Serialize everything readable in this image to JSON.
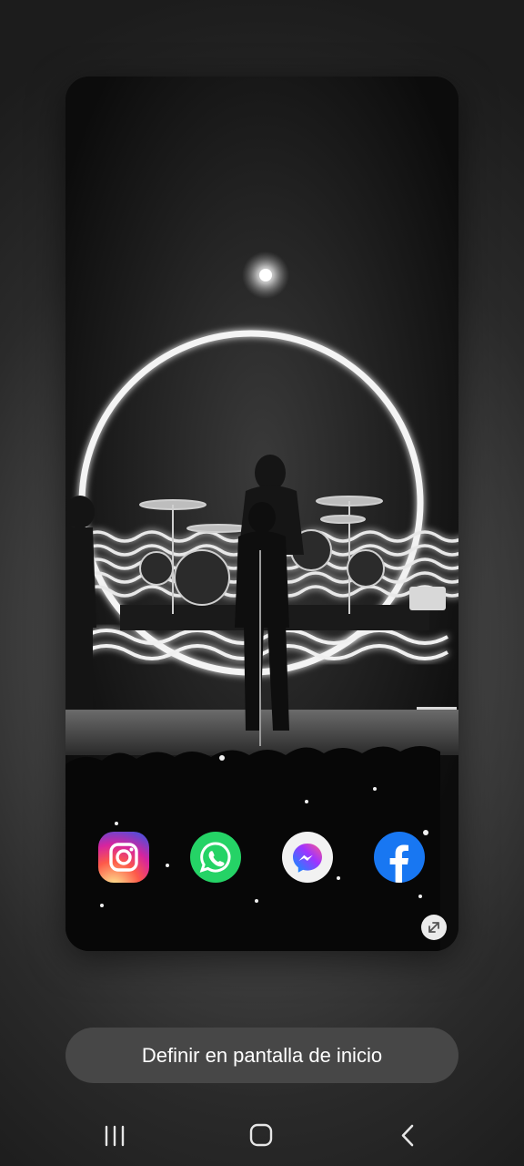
{
  "preview": {
    "wallpaper": "Black-and-white concert stage: a performer silhouetted at a microphone stand in front of a drum kit, a large glowing neon circle and wavy neon lines behind, crowd in the foreground",
    "dock_apps": [
      {
        "name": "Instagram",
        "icon": "instagram-icon",
        "color": "#d6249f"
      },
      {
        "name": "WhatsApp",
        "icon": "whatsapp-icon",
        "color": "#25D366"
      },
      {
        "name": "Messenger",
        "icon": "messenger-icon",
        "color": "#A334FA"
      },
      {
        "name": "Facebook",
        "icon": "facebook-icon",
        "color": "#1877F2"
      }
    ],
    "expand_icon": "expand-icon"
  },
  "actions": {
    "set_home_label": "Definir en pantalla de inicio"
  },
  "navbar": {
    "recents_icon": "recents-icon",
    "home_icon": "home-icon",
    "back_icon": "back-icon"
  },
  "colors": {
    "button_bg": "#474747",
    "text": "#ffffff"
  }
}
